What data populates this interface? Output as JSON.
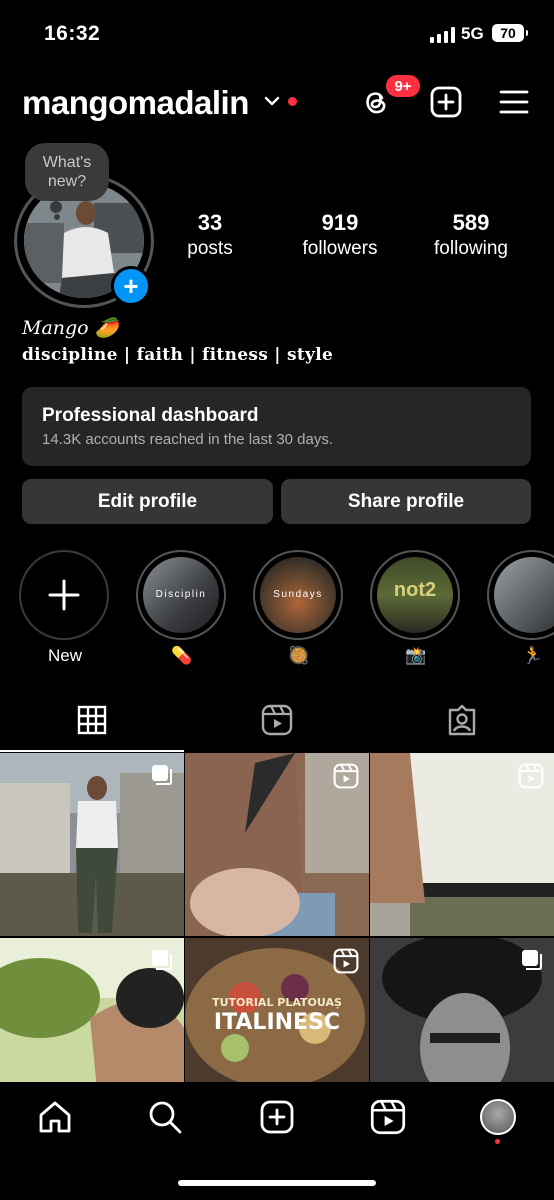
{
  "status_bar": {
    "time": "16:32",
    "network": "5G",
    "battery": "70"
  },
  "header": {
    "username": "mangomadalin",
    "notification_badge": "9+"
  },
  "profile": {
    "story_bubble": "What's new?",
    "stats": [
      {
        "value": "33",
        "label": "posts"
      },
      {
        "value": "919",
        "label": "followers"
      },
      {
        "value": "589",
        "label": "following"
      }
    ],
    "name": "Mango 🥭",
    "bio": "discipline | faith | fitness | style"
  },
  "dashboard": {
    "title": "Professional dashboard",
    "subtitle": "14.3K accounts reached in the last 30 days."
  },
  "buttons": {
    "edit": "Edit profile",
    "share": "Share profile"
  },
  "highlights": [
    {
      "label": "New"
    },
    {
      "label": "💊",
      "overlay": "Disciplin"
    },
    {
      "label": "🥘",
      "overlay": "Sundays"
    },
    {
      "label": "📸",
      "overlay": "not2"
    },
    {
      "label": "🏃"
    }
  ],
  "grid_posts": [
    {
      "type": "carousel"
    },
    {
      "type": "reel"
    },
    {
      "type": "reel"
    },
    {
      "type": "carousel"
    },
    {
      "type": "reel",
      "overlay_top": "TUTORIAL PLATOUAȘ",
      "overlay_bottom": "ITALINESC"
    },
    {
      "type": "carousel"
    }
  ],
  "colors": {
    "accent_blue": "#0095f6",
    "notification_red": "#ff3040",
    "card": "#262626",
    "button": "#363636"
  }
}
